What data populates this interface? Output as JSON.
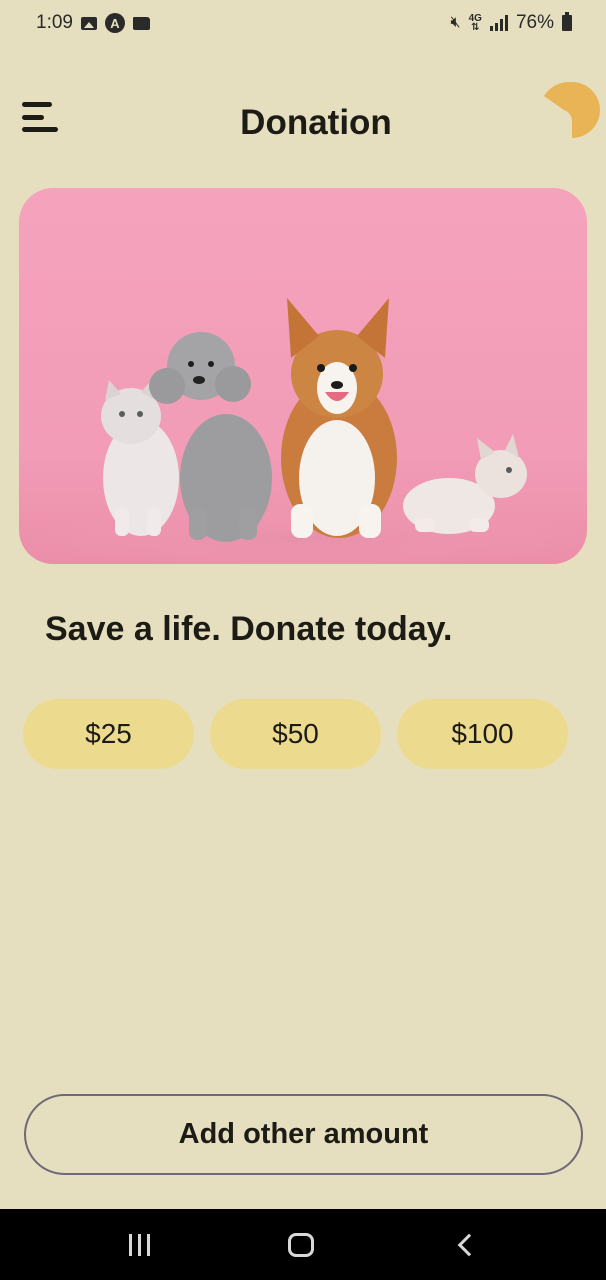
{
  "status_bar": {
    "time": "1:09",
    "battery": "76%",
    "network": "4G"
  },
  "header": {
    "title": "Donation",
    "menu_icon": "menu-icon",
    "profile_icon": "profile-shape"
  },
  "hero": {
    "image": "photo of two cats, a poodle and a corgi on pink background"
  },
  "tagline": "Save a life. Donate today.",
  "amounts": [
    "$25",
    "$50",
    "$100"
  ],
  "other_amount_label": "Add other amount",
  "colors": {
    "background": "#e6dfbf",
    "amount_button": "#ecdb8e",
    "accent": "#e8b455",
    "hero_pink": "#f5a3bd"
  }
}
